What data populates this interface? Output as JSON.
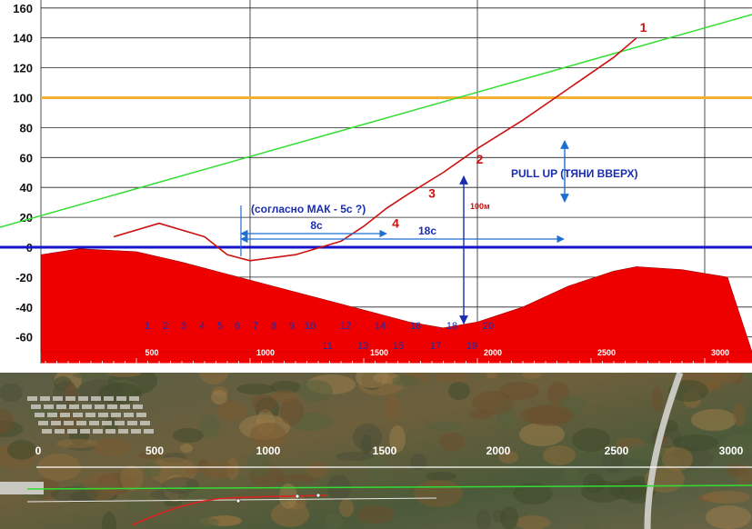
{
  "chart_data": {
    "type": "line",
    "ylim": [
      -70,
      165
    ],
    "xlim": [
      0,
      3100
    ],
    "y_ticks": [
      "160",
      "140",
      "120",
      "100",
      "80",
      "60",
      "40",
      "20",
      "0",
      "-20",
      "-40",
      "-60"
    ],
    "x_ticks": [
      "500",
      "1000",
      "1500",
      "2000",
      "2500",
      "3000"
    ],
    "grid": true,
    "reference_line": {
      "y": 100,
      "color": "#f2b230"
    },
    "zero_line": {
      "y": 0,
      "color": "#1414c8"
    },
    "glide_slope": {
      "color": "#33dd33",
      "x": [
        0,
        3100
      ],
      "y": [
        20,
        158
      ]
    },
    "terrain": {
      "color": "#ee0000",
      "x": [
        0,
        250,
        500,
        700,
        900,
        1100,
        1300,
        1500,
        1700,
        1850,
        2000,
        2200,
        2400,
        2600,
        2700,
        2900,
        3100
      ],
      "y": [
        -5,
        -1,
        -3,
        -10,
        -18,
        -26,
        -34,
        -42,
        -50,
        -54,
        -50,
        -40,
        -26,
        -16,
        -13,
        -15,
        -20
      ]
    },
    "flight_path": {
      "color": "#cc1111",
      "x": [
        400,
        600,
        800,
        900,
        1000,
        1200,
        1400,
        1500,
        1600,
        1700,
        1850,
        2000,
        2200,
        2400,
        2600,
        2700
      ],
      "y": [
        7,
        16,
        7,
        -5,
        -9,
        -5,
        4,
        14,
        26,
        36,
        50,
        66,
        85,
        106,
        127,
        140
      ],
      "labels": [
        "1",
        "2",
        "3",
        "4"
      ]
    },
    "height_marker": {
      "label": "100м"
    },
    "intervals": [
      {
        "label": "8с"
      },
      {
        "label": "18с"
      }
    ],
    "annotations": {
      "note": "(согласно МАК - 5с ?)",
      "pull_up": "PULL UP (ТЯНИ ВВЕРХ)"
    },
    "markers_top": [
      "1",
      "2",
      "3",
      "4",
      "5",
      "6",
      "7",
      "8",
      "9",
      "10",
      "12",
      "14",
      "16",
      "18",
      "20"
    ],
    "markers_bottom": [
      "11",
      "13",
      "15",
      "17",
      "19"
    ]
  },
  "map": {
    "x_ticks": [
      "0",
      "500",
      "1000",
      "1500",
      "2000",
      "2500",
      "3000"
    ]
  }
}
